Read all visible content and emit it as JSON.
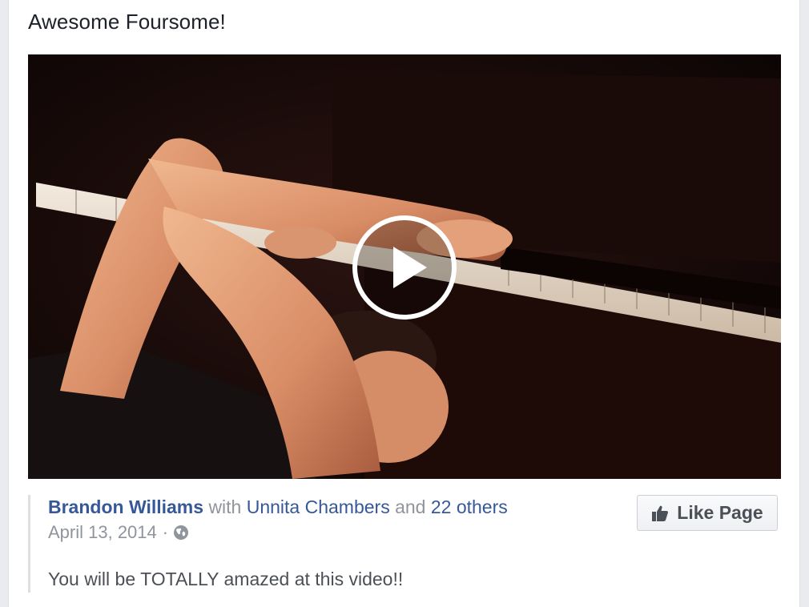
{
  "post": {
    "text": "Awesome Foursome!"
  },
  "video": {
    "play_icon": "play-circle-icon"
  },
  "attribution": {
    "author": "Brandon Williams",
    "with_word": "with",
    "tagged_person": "Unnita Chambers",
    "and_word": "and",
    "others": "22 others",
    "date": "April 13, 2014",
    "separator": "·",
    "privacy_icon": "globe-icon",
    "body": "You will be TOTALLY amazed at this video!!"
  },
  "like_page": {
    "label": "Like Page",
    "icon": "thumbs-up-icon"
  }
}
